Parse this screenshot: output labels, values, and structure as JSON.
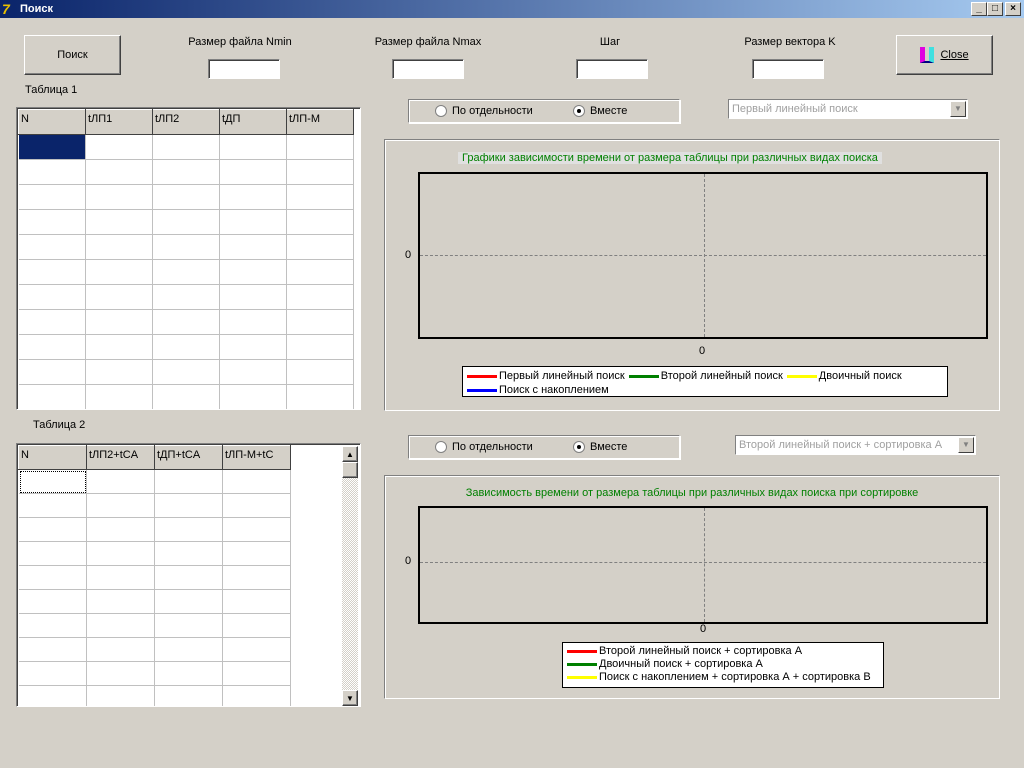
{
  "window": {
    "title": "Поиск",
    "minimize": "_",
    "maximize": "□",
    "close": "×"
  },
  "toolbar": {
    "search_label": "Поиск",
    "close_label": "Close"
  },
  "fields": [
    {
      "label": "Размер файла Nmin",
      "value": ""
    },
    {
      "label": "Размер файла Nmax",
      "value": ""
    },
    {
      "label": "Шаг",
      "value": ""
    },
    {
      "label": "Размер вектора K",
      "value": ""
    }
  ],
  "table1": {
    "label": "Таблица 1",
    "columns": [
      "N",
      "tЛП1",
      "tЛП2",
      "tДП",
      "tЛП-М"
    ]
  },
  "table2": {
    "label": "Таблица 2",
    "columns": [
      "N",
      "tЛП2+tCA",
      "tДП+tCA",
      "tЛП-М+tC"
    ]
  },
  "group1": {
    "options": [
      "По отдельности",
      "Вместе"
    ],
    "selected": 1,
    "combo": "Первый линейный поиск",
    "arrow": "▼"
  },
  "group2": {
    "options": [
      "По отдельности",
      "Вместе"
    ],
    "selected": 1,
    "combo": "Второй линейный поиск  + сортировка А",
    "arrow": "▼"
  },
  "charts": [
    {
      "title": "Графики зависимости времени от размера таблицы при различных видах поиска",
      "y_tick": "0",
      "x_tick": "0",
      "legend": [
        {
          "name": "Первый линейный поиск",
          "color": "#ff0000"
        },
        {
          "name": "Второй линейный поиск",
          "color": "#008000"
        },
        {
          "name": "Двоичный поиск",
          "color": "#ffff00"
        },
        {
          "name": "Поиск с накоплением",
          "color": "#0000ff"
        }
      ]
    },
    {
      "title": "Зависимость времени от размера таблицы при различных видах поиска при сортировке",
      "y_tick": "0",
      "x_tick": "0",
      "legend": [
        {
          "name": "Второй линейный поиск + сортировка А",
          "color": "#ff0000"
        },
        {
          "name": "Двоичный поиск + сортировка А",
          "color": "#008000"
        },
        {
          "name": "Поиск с накоплением + сортировка А +  сортировка В",
          "color": "#ffff00"
        }
      ]
    }
  ]
}
